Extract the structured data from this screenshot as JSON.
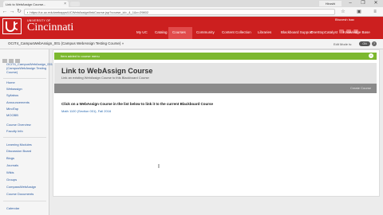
{
  "browser": {
    "tab_title": "Link to WebAssign Course...",
    "tab_close": "×",
    "profile": "Hiroshi",
    "url": "https://uc.uc.edu/webapps/UCWebAssign/linkCourse.jsp?course_id=_4_1&x=29802",
    "window": {
      "minimize": "–",
      "maximize": "❐",
      "close": "✕"
    },
    "nav": {
      "back": "←",
      "forward": "→",
      "reload": "↻"
    },
    "extensions": [
      "☆",
      "▣",
      "≡"
    ]
  },
  "uc": {
    "university_of": "UNIVERSITY OF",
    "name": "Cincinnati",
    "user": "Bhuvesh Isac",
    "nav": [
      "My UC",
      "Catalog",
      "Courses",
      "Community",
      "Content Collection",
      "Libraries",
      "Blackboard Support",
      "OneStopCatalyst",
      "Knowledge Base"
    ],
    "active_nav": "Courses"
  },
  "breadcrumb": "OCIT4_CampusWebAssign_001 (Campus WebAssign Testing Course) »",
  "edit_mode": {
    "label": "Edit Mode is:",
    "state": "ON",
    "help": "?"
  },
  "sidebar": {
    "course_title": "OCIT4_CampusWebAssign_001 (CampusWebAssign Testing Course)",
    "items": [
      {
        "label": "Home"
      },
      {
        "label": "Webassign"
      },
      {
        "label": "Syllabus"
      },
      {
        "label": "Announcements"
      },
      {
        "label": "MindTap"
      },
      {
        "label": "MOOBB"
      },
      {
        "label": "Course Overview"
      },
      {
        "label": "Faculty Info"
      },
      {
        "label": "Learning Modules"
      },
      {
        "label": "Discussion Board"
      },
      {
        "label": "Blogs"
      },
      {
        "label": "Journals"
      },
      {
        "label": "Wikis"
      },
      {
        "label": "Groups"
      },
      {
        "label": "CompassWebAssign"
      },
      {
        "label": "Course Documents"
      },
      {
        "label": "Calendar"
      }
    ]
  },
  "notice": {
    "text": "Item added to course menu",
    "close": "×"
  },
  "page": {
    "title": "Link to WebAssign Course",
    "subtitle": "Link an existing WebAssign Course to this Blackboard Course",
    "create_button": "Create Course",
    "instruction": "Click on a WebAssign Course in the list below to link it to the current Blackboard Course",
    "course_link": "Math 1100 (Section 001), Fall 2016"
  }
}
